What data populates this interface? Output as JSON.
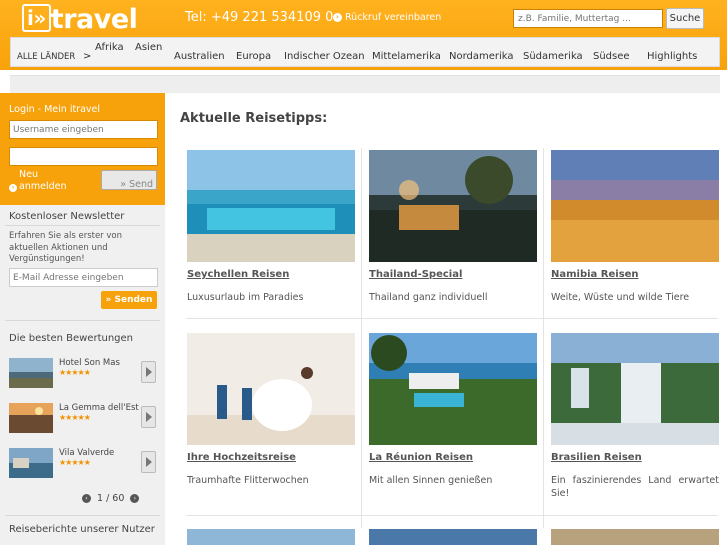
{
  "header": {
    "logo_text": "i»travel",
    "phone": "Tel: +49 221 534109 0",
    "callback": "Rückruf vereinbaren",
    "search_placeholder": "z.B. Familie, Muttertag ...",
    "search_button": "Suche"
  },
  "nav": {
    "all_label": "ALLE LÄNDER",
    "arrow": ">",
    "items": [
      "Afrika",
      "Asien",
      "Australien",
      "Europa",
      "Indischer Ozean",
      "Mittelamerika",
      "Nordamerika",
      "Südamerika",
      "Südsee",
      "Highlights"
    ]
  },
  "login": {
    "title": "Login - Mein itravel",
    "username_placeholder": "Username eingeben",
    "register": "Neu anmelden",
    "send": "» Send"
  },
  "newsletter": {
    "title": "Kostenloser Newsletter",
    "text": "Erfahren Sie als erster von aktuellen Aktionen und Vergünstigungen!",
    "email_placeholder": "E-Mail Adresse eingeben",
    "button": "» Senden"
  },
  "reviews": {
    "title": "Die besten Bewertungen",
    "items": [
      {
        "name": "Hotel Son Mas",
        "stars": "★★★★★",
        "rating": 5
      },
      {
        "name": "La Gemma dell'Est",
        "stars": "★★★★★",
        "rating": 5
      },
      {
        "name": "Vila Valverde",
        "stars": "★★★★★",
        "rating": 5
      }
    ],
    "pager": "1 / 60"
  },
  "reports_title": "Reiseberichte unserer Nutzer",
  "main": {
    "title": "Aktuelle Reisetipps:",
    "cards": [
      {
        "title": "Seychellen Reisen",
        "desc": "Luxusurlaub im Paradies"
      },
      {
        "title": "Thailand-Special",
        "desc": "Thailand ganz individuell"
      },
      {
        "title": "Namibia Reisen",
        "desc": "Weite, Wüste und wilde Tiere"
      },
      {
        "title": "Ihre Hochzeitsreise",
        "desc": "Traumhafte Flitterwochen"
      },
      {
        "title": "La Réunion Reisen",
        "desc": "Mit allen Sinnen genießen"
      },
      {
        "title": "Brasilien Reisen",
        "desc": "Ein faszinierendes Land erwartet Sie!"
      }
    ]
  },
  "colors": {
    "brand_orange": "#f7a20a",
    "star": "#f39200"
  }
}
